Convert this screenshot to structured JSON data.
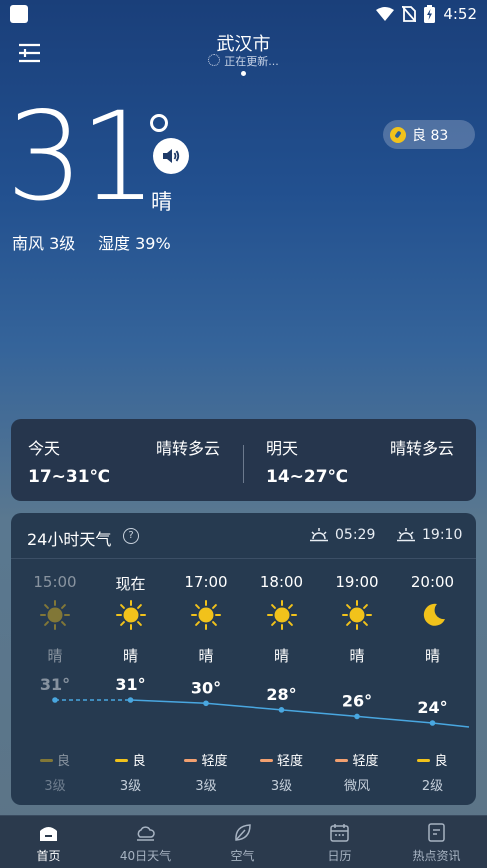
{
  "status": {
    "time": "4:52"
  },
  "header": {
    "city": "武汉市",
    "updating": "正在更新..."
  },
  "current": {
    "temp": "31",
    "weather": "晴",
    "wind": "南风 3级",
    "humidity": "湿度 39%",
    "aqi_label": "良 83"
  },
  "forecast": {
    "today": {
      "label": "今天",
      "desc": "晴转多云",
      "range": "17~31℃"
    },
    "tomorrow": {
      "label": "明天",
      "desc": "晴转多云",
      "range": "14~27℃"
    }
  },
  "hourly": {
    "title": "24小时天气",
    "help": "?",
    "sunrise": "05:29",
    "sunset": "19:10",
    "hours": [
      {
        "time": "15:00",
        "icon": "sun-icon",
        "desc": "晴",
        "temp": "31°",
        "aqi": "良",
        "aqi_color": "#f1c21b",
        "level": "3级",
        "past": true
      },
      {
        "time": "现在",
        "icon": "sun-icon",
        "desc": "晴",
        "temp": "31°",
        "aqi": "良",
        "aqi_color": "#f1c21b",
        "level": "3级",
        "past": false
      },
      {
        "time": "17:00",
        "icon": "sun-icon",
        "desc": "晴",
        "temp": "30°",
        "aqi": "轻度",
        "aqi_color": "#f2a070",
        "level": "3级",
        "past": false
      },
      {
        "time": "18:00",
        "icon": "sun-icon",
        "desc": "晴",
        "temp": "28°",
        "aqi": "轻度",
        "aqi_color": "#f2a070",
        "level": "3级",
        "past": false
      },
      {
        "time": "19:00",
        "icon": "sun-icon",
        "desc": "晴",
        "temp": "26°",
        "aqi": "轻度",
        "aqi_color": "#f2a070",
        "level": "微风",
        "past": false
      },
      {
        "time": "20:00",
        "icon": "moon-icon",
        "desc": "晴",
        "temp": "24°",
        "aqi": "良",
        "aqi_color": "#f1c21b",
        "level": "2级",
        "past": false
      }
    ]
  },
  "chart_data": {
    "type": "line",
    "categories": [
      "15:00",
      "现在",
      "17:00",
      "18:00",
      "19:00",
      "20:00"
    ],
    "values": [
      31,
      31,
      30,
      28,
      26,
      24
    ]
  },
  "nav": {
    "items": [
      {
        "label": "首页",
        "active": true
      },
      {
        "label": "40日天气",
        "active": false
      },
      {
        "label": "空气",
        "active": false
      },
      {
        "label": "日历",
        "active": false
      },
      {
        "label": "热点资讯",
        "active": false
      }
    ]
  },
  "colors": {
    "accent_line": "#49a7e0",
    "sun": "#f1c21b"
  }
}
